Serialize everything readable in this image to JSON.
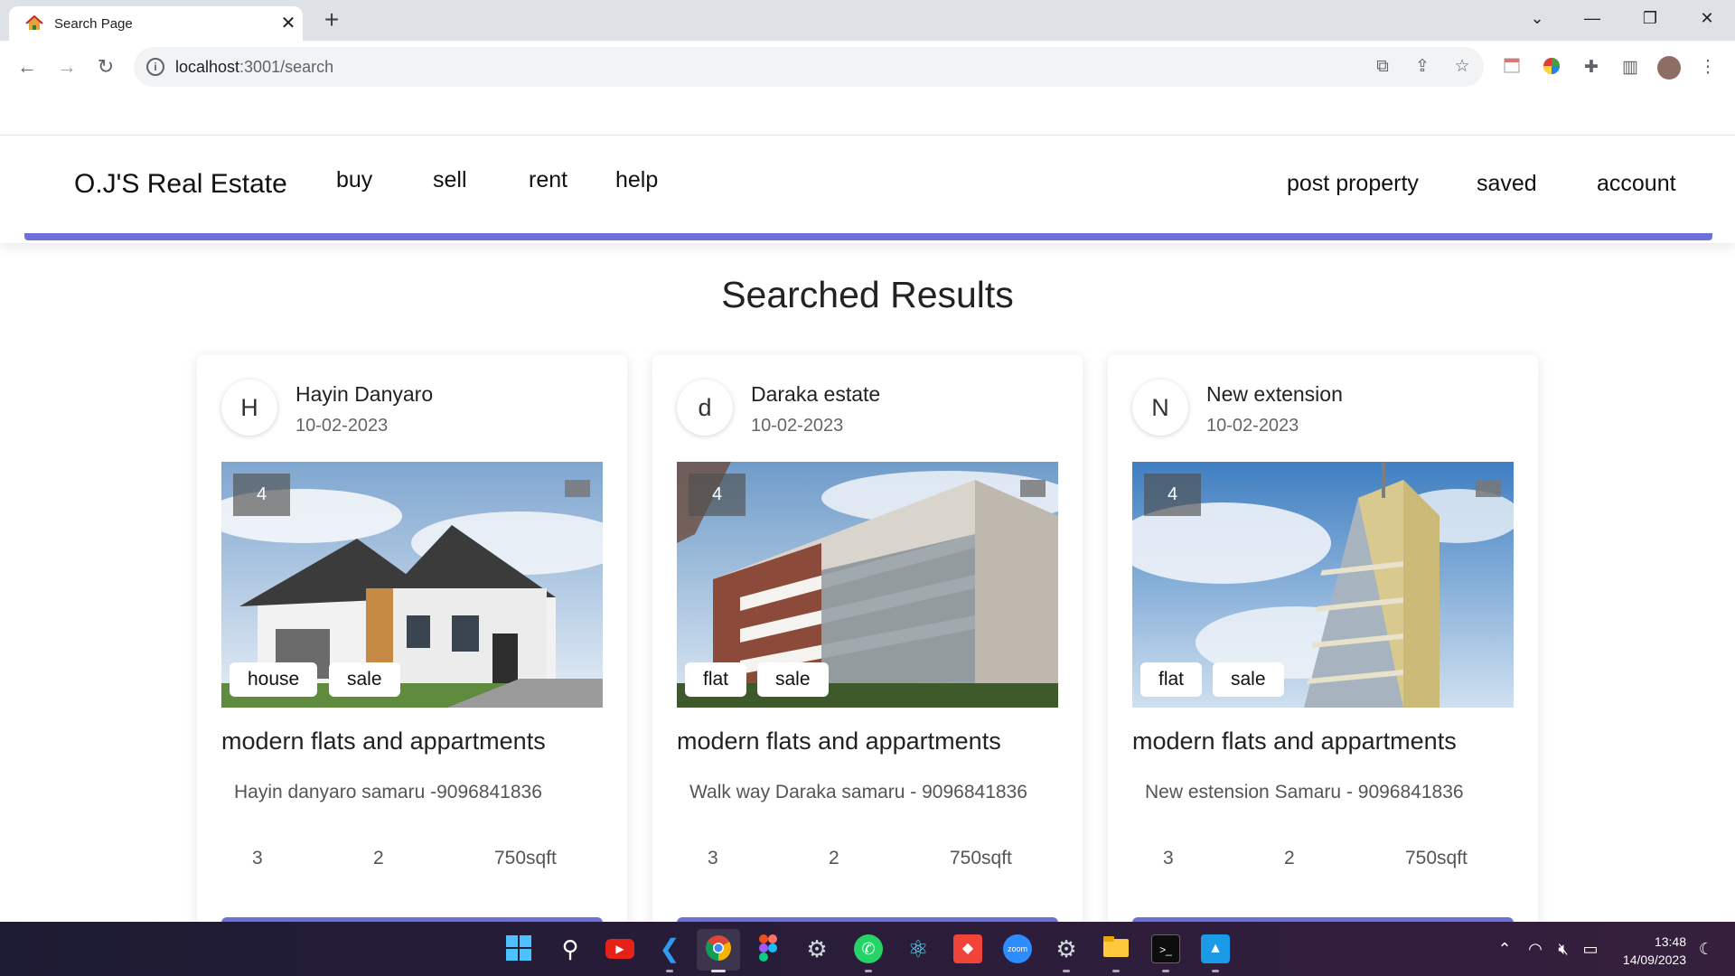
{
  "browser": {
    "tab_title": "Search Page",
    "tab_close": "✕",
    "new_tab": "+",
    "url_host": "localhost",
    "url_rest": ":3001/search",
    "window_controls": [
      "⌄",
      "—",
      "❐",
      "✕"
    ]
  },
  "site": {
    "brand": "O.J'S Real Estate",
    "nav_left": [
      "buy",
      "sell",
      "rent",
      "help"
    ],
    "nav_right": [
      "post property",
      "saved",
      "account"
    ],
    "accent_color": "#6c70d8"
  },
  "results": {
    "heading": "Searched Results",
    "cards": [
      {
        "avatar_letter": "H",
        "name": "Hayin Danyaro",
        "date": "10-02-2023",
        "image_count": "4",
        "tags": [
          "house",
          "sale"
        ],
        "title": "modern flats and appartments",
        "address": "Hayin danyaro samaru -9096841836",
        "beds": "3",
        "baths": "2",
        "area": "750sqft"
      },
      {
        "avatar_letter": "d",
        "name": "Daraka estate",
        "date": "10-02-2023",
        "image_count": "4",
        "tags": [
          "flat",
          "sale"
        ],
        "title": "modern flats and appartments",
        "address": "Walk way Daraka samaru - 9096841836",
        "beds": "3",
        "baths": "2",
        "area": "750sqft"
      },
      {
        "avatar_letter": "N",
        "name": "New extension",
        "date": "10-02-2023",
        "image_count": "4",
        "tags": [
          "flat",
          "sale"
        ],
        "title": "modern flats and appartments",
        "address": "New estension Samaru - 9096841836",
        "beds": "3",
        "baths": "2",
        "area": "750sqft"
      }
    ]
  },
  "taskbar": {
    "time": "13:48",
    "date": "14/09/2023"
  }
}
